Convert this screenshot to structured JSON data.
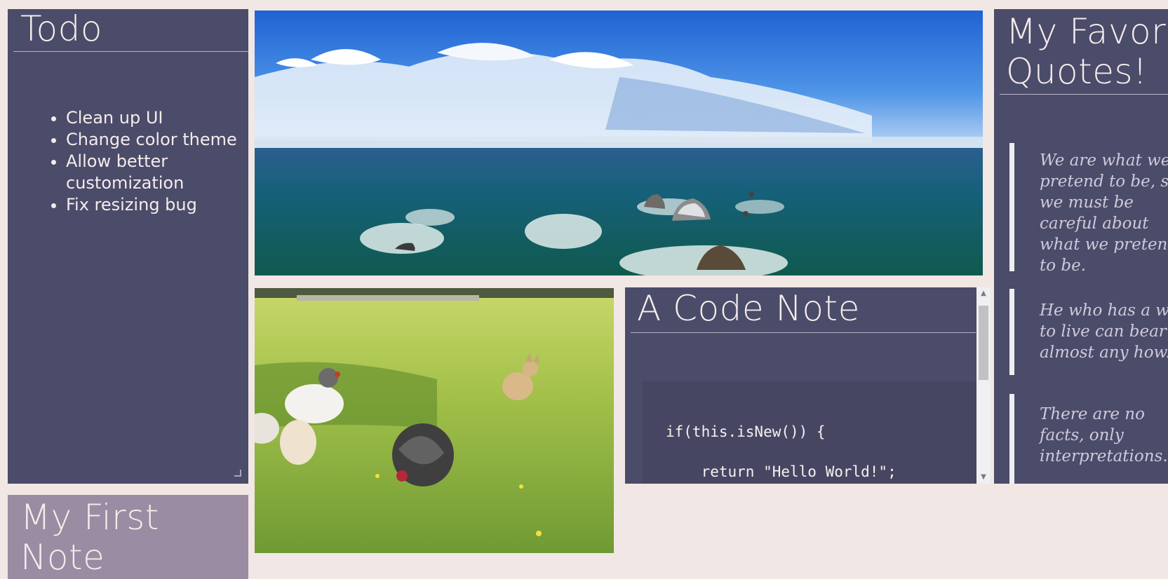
{
  "todo": {
    "title": "Todo",
    "items": [
      "Clean up UI",
      "Change color theme",
      "Allow better customization",
      "Fix resizing bug"
    ]
  },
  "first_note": {
    "title": "My First Note"
  },
  "code_note": {
    "title": "A Code Note",
    "code_lines": [
      "if(this.isNew()) {",
      "    return \"Hello World!\";"
    ]
  },
  "quotes_note": {
    "title": "My Favorite Quotes!",
    "quotes": [
      "We are what we pretend to be, so we must be careful about what we pretend to be.",
      "He who has a why to live can bear almost any how.",
      "There are no facts, only interpretations."
    ]
  },
  "images": {
    "ocean_alt": "Ocean panorama with rocks",
    "chickens_alt": "Chickens and a dog on grass"
  },
  "colors": {
    "page_background": "#f1e7e4",
    "note_background": "#4b4b6a",
    "first_note_background": "#9a8ca2",
    "note_text": "#f4ecea"
  }
}
